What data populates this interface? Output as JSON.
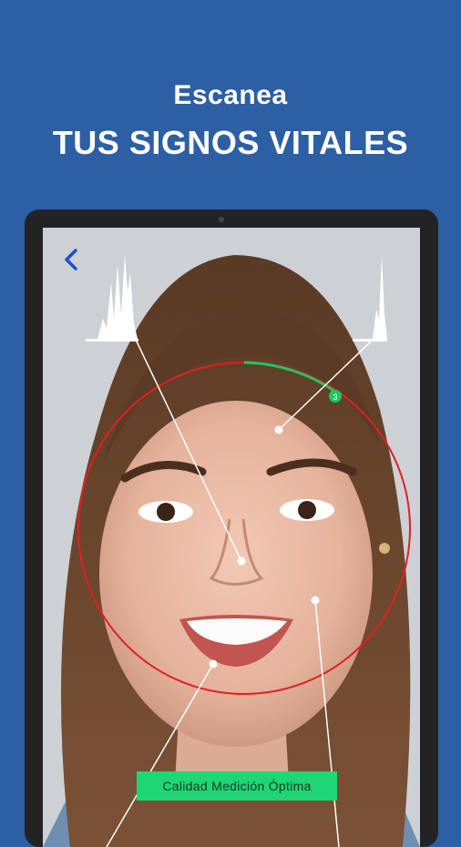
{
  "headline": {
    "subtitle": "Escanea",
    "title": "TUS SIGNOS VITALES"
  },
  "scan": {
    "quality_label": "Calidad Medición Óptima",
    "progress_dot": "3"
  },
  "icons": {
    "back": "chevron-left-icon"
  },
  "colors": {
    "background": "#2c5fa3",
    "ring": "#e02020",
    "progress": "#22c55e",
    "badge": "#1fd576"
  }
}
